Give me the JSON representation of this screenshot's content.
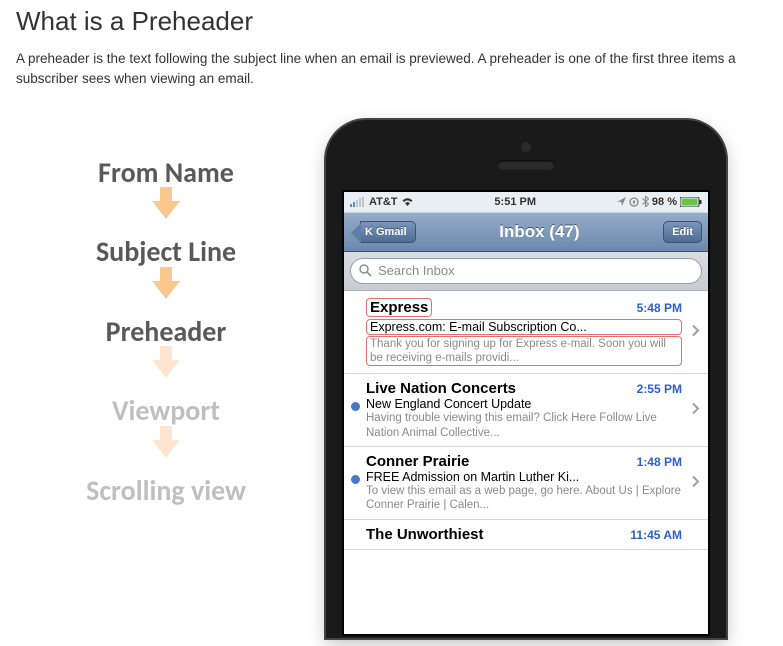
{
  "title": "What is a Preheader",
  "intro": "A preheader is the text following the subject line when an email is previewed. A preheader is one of the first three items a subscriber sees when viewing an email.",
  "flow": {
    "step1": "From Name",
    "step2": "Subject Line",
    "step3": "Preheader",
    "step4": "Viewport",
    "step5": "Scrolling view"
  },
  "status": {
    "carrier": "AT&T",
    "time": "5:51 PM",
    "battery": "98 %"
  },
  "nav": {
    "back": "K Gmail",
    "title": "Inbox (47)",
    "edit": "Edit"
  },
  "search": {
    "placeholder": "Search Inbox"
  },
  "emails": [
    {
      "sender": "Express",
      "time": "5:48 PM",
      "subject": "Express.com: E-mail Subscription Co...",
      "preview": "Thank you for signing up for Express e-mail. Soon you will be receiving e-mails providi...",
      "unread": false,
      "highlight": true
    },
    {
      "sender": "Live Nation Concerts",
      "time": "2:55 PM",
      "subject": "New England Concert Update",
      "preview": "Having trouble viewing this email? Click Here Follow Live Nation Animal Collective...",
      "unread": true,
      "highlight": false
    },
    {
      "sender": "Conner Prairie",
      "time": "1:48 PM",
      "subject": "FREE Admission on Martin Luther Ki...",
      "preview": "To view this email as a web page, go here. About Us | Explore Conner Prairie | Calen...",
      "unread": true,
      "highlight": false
    },
    {
      "sender": "The Unworthiest",
      "time": "11:45 AM",
      "subject": "",
      "preview": "",
      "unread": false,
      "highlight": false
    }
  ]
}
